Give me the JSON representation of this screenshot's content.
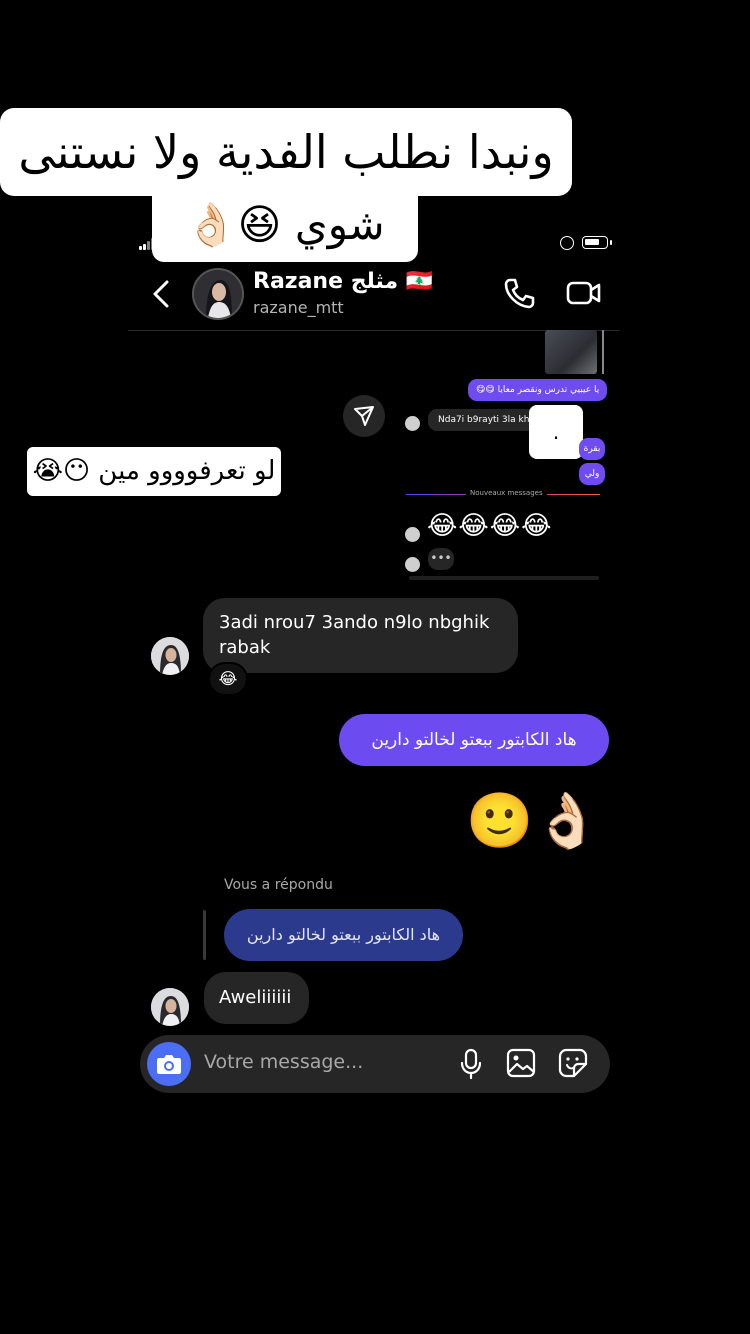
{
  "overlay": {
    "caption_line1": "ونبدا نطلب الفدية ولا نستنى",
    "caption_line2": "شوي 😆👌🏻",
    "side_caption": "لو تعرفوووو مين 😶😭"
  },
  "header": {
    "display_name": "Razane مثلج 🇱🇧",
    "username": "razane_mtt"
  },
  "shared_screenshot": {
    "purple_message_1": "يا عيبيي تدرس ونقصر معايا 😋😋",
    "gray_message": "Nda7i b9rayti 3la khater",
    "purple_message_2": "بقرة",
    "purple_message_3": "ولي",
    "separator_label": "Nouveaux messages",
    "emojis": "😂😂😂😂",
    "typing": "•••",
    "white_square_text": "."
  },
  "chat": {
    "message_1": "3adi nrou7 3ando n9lo nbghik rabak",
    "message_1_reaction": "😂",
    "message_2": "هاد الكابتور ببعتو لخالتو دارين",
    "message_3": "🙂👌🏻",
    "replied_label": "Vous a répondu",
    "quoted_message": "هاد الكابتور ببعتو لخالتو دارين",
    "message_4": "Aweliiiiii"
  },
  "composer": {
    "placeholder": "Votre message..."
  },
  "status": {
    "battery_level": 0.75
  },
  "colors": {
    "sent_bubble": "#6c4cf1",
    "received_bubble": "#262626",
    "quoted_bubble": "#2c3a8e",
    "camera_button": "#4c6ef5"
  }
}
